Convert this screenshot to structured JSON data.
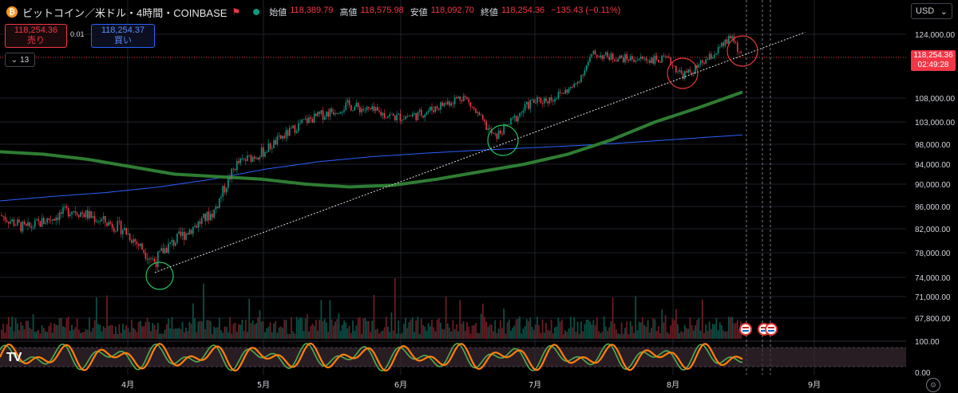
{
  "header": {
    "coin_icon": "bitcoin-icon",
    "title": "ビットコイン／米ドル・4時間・COINBASE",
    "flag_icon": "flag-icon",
    "ohlc": [
      {
        "label": "始値",
        "value": "118,389.79"
      },
      {
        "label": "高値",
        "value": "118,575.98"
      },
      {
        "label": "安値",
        "value": "118,092.70"
      },
      {
        "label": "終値",
        "value": "118,254.36"
      }
    ],
    "change": "−135.43 (−0.11%)"
  },
  "trade": {
    "sell_price": "118,254.36",
    "sell_label": "売り",
    "spread": "0.01",
    "buy_price": "118,254.37",
    "buy_label": "買い"
  },
  "indicators_toggle": "13",
  "currency": "USD",
  "price_tag": {
    "price": "118,254.36",
    "countdown": "02:49:28"
  },
  "colors": {
    "up": "#089981",
    "down": "#f23645",
    "ma_long": "#2e7d32",
    "ma_blue": "#2962ff",
    "osc_orange": "#ff7f0e",
    "osc_green": "#4caf50"
  },
  "chart_data": {
    "type": "line",
    "price_axis_labels": [
      "124,000.00",
      "108,000.00",
      "103,000.00",
      "98,000.00",
      "94,000.00",
      "90,000.00",
      "86,000.00",
      "82,000.00",
      "78,000.00",
      "74,000.00",
      "71,000.00",
      "67,800.00"
    ],
    "oscillator_axis_labels": [
      "100.00",
      "0.00"
    ],
    "time_axis_labels": [
      "4月",
      "5月",
      "6月",
      "7月",
      "8月",
      "9月"
    ],
    "price_series": {
      "name": "",
      "x": [
        "3/1",
        "3/10",
        "3/20",
        "3/31",
        "4/7",
        "4/9",
        "4/20",
        "4/25",
        "5/1",
        "5/10",
        "5/20",
        "5/31",
        "6/5",
        "6/15",
        "6/22",
        "6/30",
        "7/5",
        "7/10",
        "7/14",
        "7/20",
        "7/31",
        "8/3",
        "8/5",
        "8/10",
        "8/14",
        "8/16"
      ],
      "y": [
        86000,
        82000,
        85500,
        82000,
        76500,
        78500,
        85000,
        94000,
        96500,
        103000,
        106500,
        104000,
        104500,
        108500,
        99500,
        107000,
        108000,
        111000,
        119000,
        118000,
        117500,
        113800,
        114500,
        119000,
        123500,
        118254
      ]
    },
    "ma_long_green": [
      96500,
      96000,
      95000,
      93500,
      92000,
      91500,
      91000,
      90000,
      89500,
      89800,
      91000,
      92500,
      94000,
      96000,
      99000,
      103000,
      106000,
      109500
    ],
    "ma_blue": [
      87000,
      87800,
      88500,
      89500,
      91000,
      93000,
      94500,
      95500,
      96200,
      96800,
      97300,
      97800,
      98500,
      99300,
      100100
    ],
    "volume_note": "",
    "trendline": {
      "from": {
        "x": "4/7",
        "y": 74800
      },
      "to": {
        "x": "8/30",
        "y": 124500
      }
    },
    "annotations": [
      "green-circle-low-4月",
      "green-circle-low-6月",
      "red-circle-high-8月",
      "red-circle-high-8月後半"
    ],
    "ylim": [
      65000,
      126000
    ],
    "grid": true,
    "legend": "none"
  }
}
